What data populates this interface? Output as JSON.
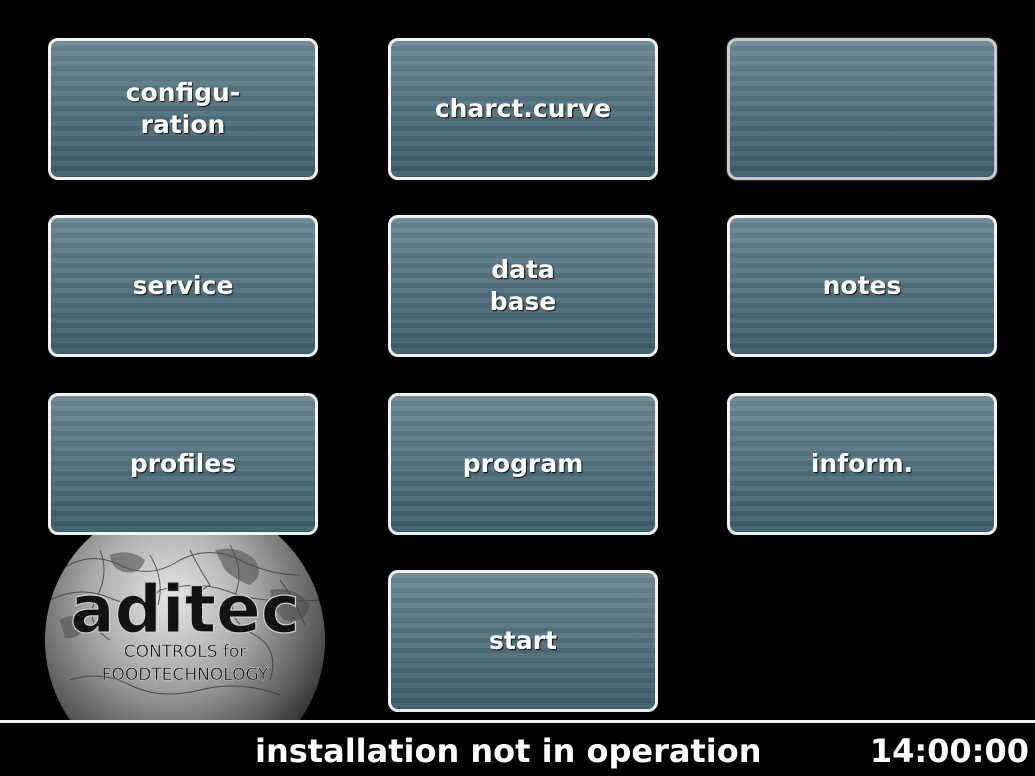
{
  "menu": {
    "configuration_label": "configu-\nration",
    "charct_curve_label": "charct.curve",
    "empty_label": "",
    "service_label": "service",
    "data_base_label": "data\nbase",
    "notes_label": "notes",
    "profiles_label": "profiles",
    "program_label": "program",
    "inform_label": "inform.",
    "start_label": "start"
  },
  "logo": {
    "brand": "aditec",
    "tagline_1": "CONTROLS for",
    "tagline_2": "FOODTECHNOLOGY"
  },
  "status": {
    "message": "installation not in operation",
    "time": "14:00:00"
  },
  "colors": {
    "background": "#000000",
    "tile_top": "#6a8793",
    "tile_bottom": "#3c5c68",
    "tile_border": "#f2f2f2",
    "text": "#ffffff"
  }
}
